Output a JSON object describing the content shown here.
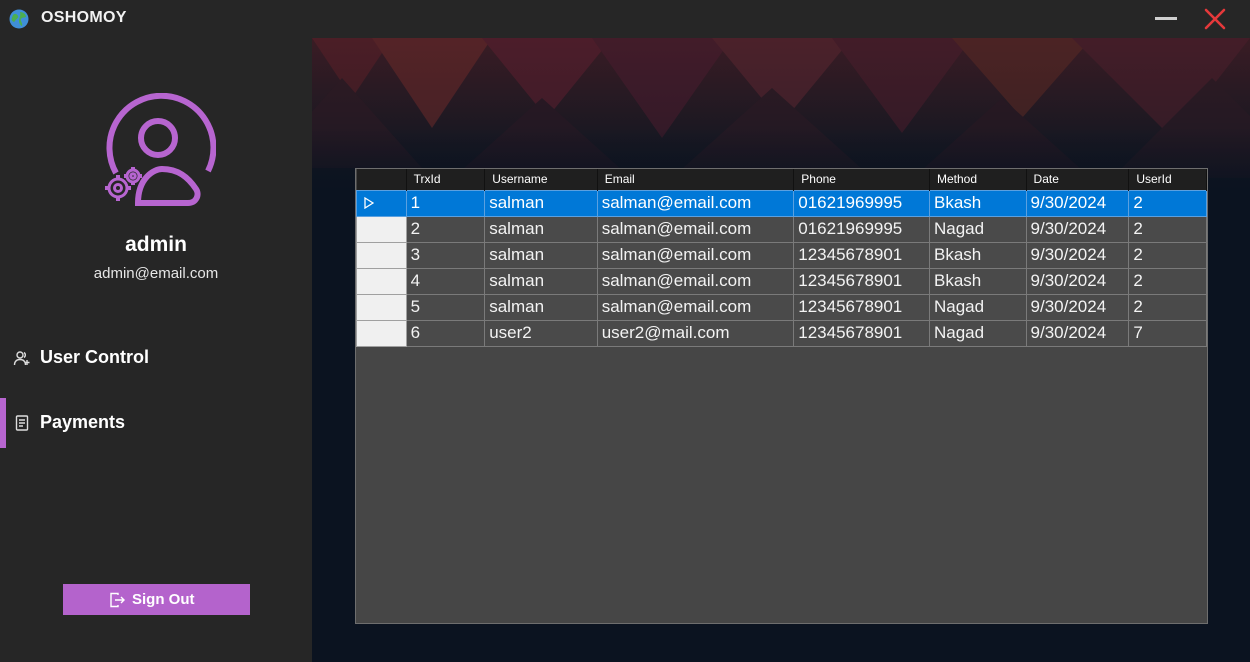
{
  "window": {
    "title": "OSHOMOY"
  },
  "sidebar": {
    "user_name": "admin",
    "user_email": "admin@email.com",
    "nav": [
      {
        "label": "User Control",
        "icon": "users-icon",
        "active": false
      },
      {
        "label": "Payments",
        "icon": "receipt-icon",
        "active": true
      }
    ],
    "sign_out_label": "Sign Out"
  },
  "colors": {
    "accent": "#b765d0",
    "selection": "#0078d7"
  },
  "table": {
    "columns": [
      "TrxId",
      "Username",
      "Email",
      "Phone",
      "Method",
      "Date",
      "UserId"
    ],
    "rows": [
      [
        "1",
        "salman",
        "salman@email.com",
        "01621969995",
        "Bkash",
        "9/30/2024",
        "2"
      ],
      [
        "2",
        "salman",
        "salman@email.com",
        "01621969995",
        "Nagad",
        "9/30/2024",
        "2"
      ],
      [
        "3",
        "salman",
        "salman@email.com",
        "12345678901",
        "Bkash",
        "9/30/2024",
        "2"
      ],
      [
        "4",
        "salman",
        "salman@email.com",
        "12345678901",
        "Bkash",
        "9/30/2024",
        "2"
      ],
      [
        "5",
        "salman",
        "salman@email.com",
        "12345678901",
        "Nagad",
        "9/30/2024",
        "2"
      ],
      [
        "6",
        "user2",
        "user2@mail.com",
        "12345678901",
        "Nagad",
        "9/30/2024",
        "7"
      ]
    ],
    "selected_row": 0
  }
}
